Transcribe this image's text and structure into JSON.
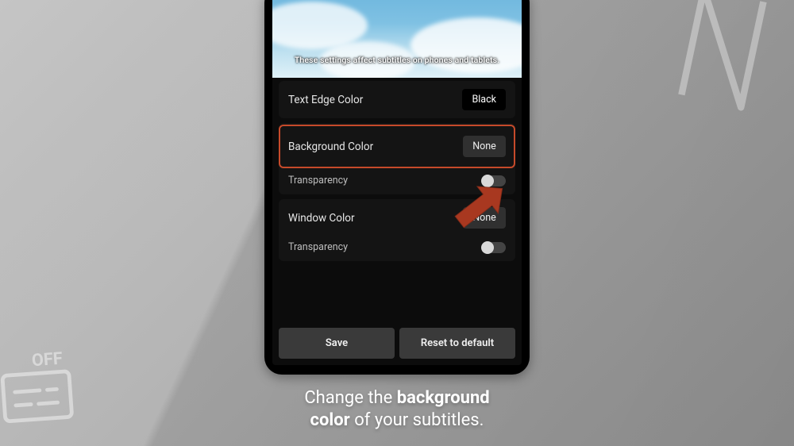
{
  "preview": {
    "text": "These settings affect subtitles on phones and tablets."
  },
  "settings": {
    "text_edge_color": {
      "label": "Text Edge Color",
      "value": "Black"
    },
    "background_color": {
      "label": "Background Color",
      "value": "None"
    },
    "bg_transparency": {
      "label": "Transparency",
      "on": false
    },
    "window_color": {
      "label": "Window Color",
      "value": "None"
    },
    "win_transparency": {
      "label": "Transparency",
      "on": false
    }
  },
  "buttons": {
    "save": "Save",
    "reset": "Reset to default"
  },
  "caption": {
    "prefix": "Change the ",
    "bold1": "background",
    "bold2": "color",
    "suffix": " of your subtitles."
  },
  "annotation": {
    "arrow_color": "#a83820",
    "highlight_color": "#c64a2a"
  }
}
